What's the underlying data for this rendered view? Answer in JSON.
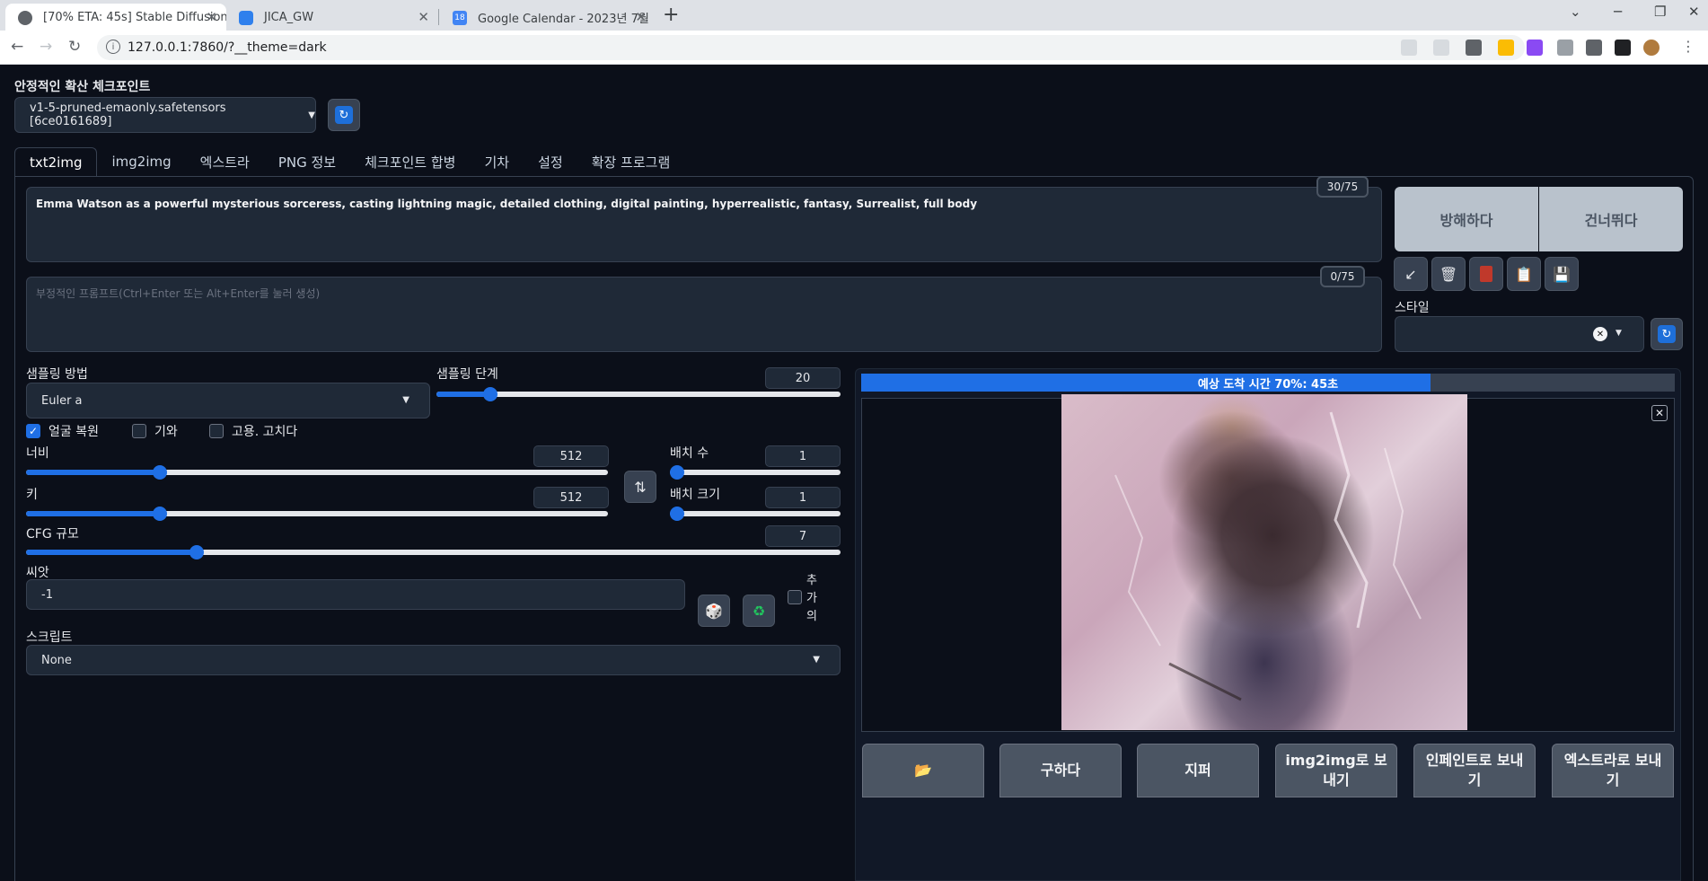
{
  "browser": {
    "tabs": [
      {
        "title": "[70% ETA: 45s] Stable Diffusion"
      },
      {
        "title": "JICA_GW"
      },
      {
        "title": "Google Calendar - 2023년 7월"
      }
    ],
    "new_tab": "+",
    "url": "127.0.0.1:7860/?__theme=dark",
    "calendar_badge": "18"
  },
  "checkpoint": {
    "label": "안정적인 확산 체크포인트",
    "value": "v1-5-pruned-emaonly.safetensors [6ce0161689]"
  },
  "tabs": [
    "txt2img",
    "img2img",
    "엑스트라",
    "PNG 정보",
    "체크포인트 합병",
    "기차",
    "설정",
    "확장 프로그램"
  ],
  "prompt": {
    "value": "Emma Watson as a powerful mysterious sorceress, casting lightning magic, detailed clothing, digital painting, hyperrealistic, fantasy, Surrealist, full body",
    "counter": "30/75"
  },
  "negative_prompt": {
    "placeholder": "부정적인 프롬프트(Ctrl+Enter 또는 Alt+Enter를 눌러 생성)",
    "counter": "0/75"
  },
  "actions": {
    "interrupt": "방해하다",
    "skip": "건너뛰다"
  },
  "styles_label": "스타일",
  "sampling": {
    "method_label": "샘플링 방법",
    "method_value": "Euler a",
    "steps_label": "샘플링 단계",
    "steps": 20,
    "steps_max": 150
  },
  "checks": {
    "face_restore": "얼굴 복원",
    "tiling": "기와",
    "hires_fix": "고용. 고치다"
  },
  "width": {
    "label": "너비",
    "value": 512,
    "fraction": 0.23
  },
  "height": {
    "label": "키",
    "value": 512,
    "fraction": 0.23
  },
  "batch_count": {
    "label": "배치 수",
    "value": 1
  },
  "batch_size": {
    "label": "배치 크기",
    "value": 1
  },
  "cfg": {
    "label": "CFG 규모",
    "value": 7,
    "fraction": 0.21
  },
  "seed": {
    "label": "씨앗",
    "value": "-1",
    "extra": "추가의"
  },
  "script": {
    "label": "스크립트",
    "value": "None"
  },
  "progress": {
    "text": "예상 도착 시간 70%: 45초",
    "fraction": 0.7
  },
  "output_buttons": [
    "구하다",
    "지퍼",
    "img2img로 보내기",
    "인페인트로 보내기",
    "엑스트라로 보내기"
  ]
}
